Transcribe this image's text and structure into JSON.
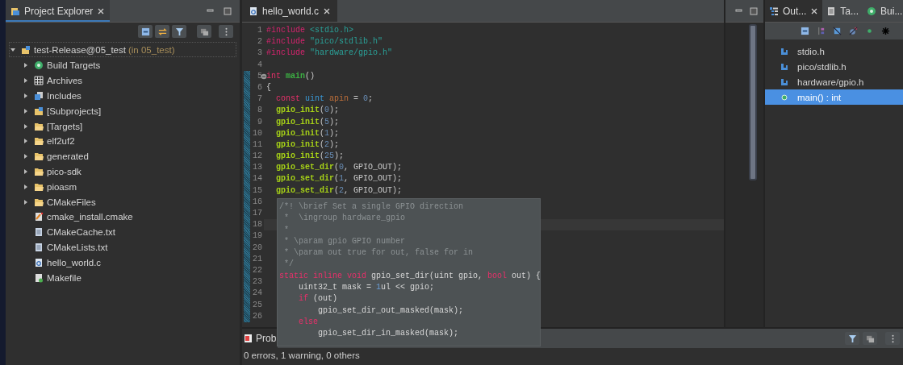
{
  "project_explorer": {
    "tab": {
      "label": "Project Explorer",
      "selected": true
    },
    "root": {
      "label": "test-Release@05_test",
      "suffix": "(in 05_test)",
      "expanded": true,
      "focused": true,
      "children": [
        {
          "label": "Build Targets",
          "kind": "targets",
          "expandable": true
        },
        {
          "label": "Archives",
          "kind": "archives",
          "expandable": true
        },
        {
          "label": "Includes",
          "kind": "includes",
          "expandable": true
        },
        {
          "label": "[Subprojects]",
          "kind": "subprojects",
          "expandable": true
        },
        {
          "label": "[Targets]",
          "kind": "folder",
          "expandable": true
        },
        {
          "label": "elf2uf2",
          "kind": "folder",
          "expandable": true
        },
        {
          "label": "generated",
          "kind": "folder",
          "expandable": true
        },
        {
          "label": "pico-sdk",
          "kind": "folder",
          "expandable": true
        },
        {
          "label": "pioasm",
          "kind": "folder",
          "expandable": true
        },
        {
          "label": "CMakeFiles",
          "kind": "folder",
          "expandable": true
        },
        {
          "label": "cmake_install.cmake",
          "kind": "cmake",
          "expandable": false
        },
        {
          "label": "CMakeCache.txt",
          "kind": "text",
          "expandable": false
        },
        {
          "label": "CMakeLists.txt",
          "kind": "text",
          "expandable": false
        },
        {
          "label": "hello_world.c",
          "kind": "csource",
          "expandable": false
        },
        {
          "label": "Makefile",
          "kind": "makefile",
          "expandable": false
        }
      ]
    }
  },
  "editor": {
    "tab": {
      "label": "hello_world.c",
      "selected": true
    },
    "lines": [
      {
        "number": "1",
        "tokens": [
          {
            "text": "#include",
            "kind": "pre"
          },
          {
            "text": " <stdio.h>",
            "kind": "str"
          }
        ]
      },
      {
        "number": "2",
        "tokens": [
          {
            "text": "#include",
            "kind": "pre"
          },
          {
            "text": " \"pico/stdlib.h\"",
            "kind": "str"
          }
        ]
      },
      {
        "number": "3",
        "tokens": [
          {
            "text": "#include",
            "kind": "pre"
          },
          {
            "text": " \"hardware/gpio.h\"",
            "kind": "str"
          }
        ]
      },
      {
        "number": "4"
      },
      {
        "number": "5",
        "changed": true,
        "tokens": [
          {
            "text": "int",
            "kind": "kw"
          },
          {
            "text": " main",
            "kind": "entry"
          },
          {
            "text": "()",
            "kind": "plain"
          }
        ]
      },
      {
        "number": "6",
        "changed": true,
        "tokens": [
          {
            "text": "{",
            "kind": "plain"
          }
        ]
      },
      {
        "number": "7",
        "changed": true,
        "tokens": [
          {
            "text": "  const",
            "kind": "kw"
          },
          {
            "text": " uint",
            "kind": "type"
          },
          {
            "text": " apin",
            "kind": "var"
          },
          {
            "text": " = ",
            "kind": "plain"
          },
          {
            "text": "0",
            "kind": "num"
          },
          {
            "text": ";",
            "kind": "plain"
          }
        ]
      },
      {
        "number": "8",
        "changed": true,
        "tokens": [
          {
            "text": "  gpio_init",
            "kind": "fn"
          },
          {
            "text": "(",
            "kind": "plain"
          },
          {
            "text": "0",
            "kind": "num"
          },
          {
            "text": ");",
            "kind": "plain"
          }
        ]
      },
      {
        "number": "9",
        "changed": true,
        "tokens": [
          {
            "text": "  gpio_init",
            "kind": "fn"
          },
          {
            "text": "(",
            "kind": "plain"
          },
          {
            "text": "5",
            "kind": "num"
          },
          {
            "text": ");",
            "kind": "plain"
          }
        ]
      },
      {
        "number": "10",
        "changed": true,
        "tokens": [
          {
            "text": "  gpio_init",
            "kind": "fn"
          },
          {
            "text": "(",
            "kind": "plain"
          },
          {
            "text": "1",
            "kind": "num"
          },
          {
            "text": ");",
            "kind": "plain"
          }
        ]
      },
      {
        "number": "11",
        "changed": true,
        "tokens": [
          {
            "text": "  gpio_init",
            "kind": "fn"
          },
          {
            "text": "(",
            "kind": "plain"
          },
          {
            "text": "2",
            "kind": "num"
          },
          {
            "text": ");",
            "kind": "plain"
          }
        ]
      },
      {
        "number": "12",
        "changed": true,
        "tokens": [
          {
            "text": "  gpio_init",
            "kind": "fn"
          },
          {
            "text": "(",
            "kind": "plain"
          },
          {
            "text": "25",
            "kind": "num"
          },
          {
            "text": ");",
            "kind": "plain"
          }
        ]
      },
      {
        "number": "13",
        "changed": true,
        "tokens": [
          {
            "text": "  gpio_set_dir",
            "kind": "fn"
          },
          {
            "text": "(",
            "kind": "plain"
          },
          {
            "text": "0",
            "kind": "num"
          },
          {
            "text": ", GPIO_OUT);",
            "kind": "plain"
          }
        ]
      },
      {
        "number": "14",
        "changed": true,
        "tokens": [
          {
            "text": "  gpio_set_dir",
            "kind": "fn"
          },
          {
            "text": "(",
            "kind": "plain"
          },
          {
            "text": "1",
            "kind": "num"
          },
          {
            "text": ", GPIO_OUT);",
            "kind": "plain"
          }
        ]
      },
      {
        "number": "15",
        "changed": true,
        "tokens": [
          {
            "text": "  gpio_set_dir",
            "kind": "fn"
          },
          {
            "text": "(",
            "kind": "plain"
          },
          {
            "text": "2",
            "kind": "num"
          },
          {
            "text": ", GPIO_OUT);",
            "kind": "plain"
          }
        ]
      },
      {
        "number": "16",
        "changed": true
      },
      {
        "number": "17",
        "changed": true
      },
      {
        "number": "18",
        "changed": true
      },
      {
        "number": "19",
        "changed": true
      },
      {
        "number": "20",
        "changed": true
      },
      {
        "number": "21",
        "changed": true
      },
      {
        "number": "22",
        "changed": true
      },
      {
        "number": "23",
        "changed": true
      },
      {
        "number": "24",
        "changed": true
      },
      {
        "number": "25",
        "changed": true
      },
      {
        "number": "26",
        "changed": true
      }
    ]
  },
  "hover": {
    "lines": [
      [
        {
          "text": "/*! \\brief Set a single GPIO direction",
          "kind": "comment"
        }
      ],
      [
        {
          "text": " *  \\ingroup hardware_gpio",
          "kind": "comment"
        }
      ],
      [
        {
          "text": " *",
          "kind": "comment"
        }
      ],
      [
        {
          "text": " * \\param gpio GPIO number",
          "kind": "comment"
        }
      ],
      [
        {
          "text": " * \\param out true for out, false for in",
          "kind": "comment"
        }
      ],
      [
        {
          "text": " */",
          "kind": "comment"
        }
      ],
      [
        {
          "text": "static",
          "kind": "kw"
        },
        {
          "text": " inline",
          "kind": "kw"
        },
        {
          "text": " void",
          "kind": "kw"
        },
        {
          "text": " gpio_set_dir(uint gpio, ",
          "kind": "plain"
        },
        {
          "text": "bool",
          "kind": "kw"
        },
        {
          "text": " out) {",
          "kind": "plain"
        }
      ],
      [
        {
          "text": "    uint32_t mask = ",
          "kind": "plain"
        },
        {
          "text": "1",
          "kind": "num"
        },
        {
          "text": "ul << gpio;",
          "kind": "plain"
        }
      ],
      [
        {
          "text": "    if",
          "kind": "kw"
        },
        {
          "text": " (out)",
          "kind": "plain"
        }
      ],
      [
        {
          "text": "        gpio_set_dir_out_masked(mask);",
          "kind": "plain"
        }
      ],
      [
        {
          "text": "    else",
          "kind": "kw"
        }
      ],
      [
        {
          "text": "        gpio_set_dir_in_masked(mask);",
          "kind": "plain"
        }
      ]
    ]
  },
  "right_tabs": [
    {
      "label": "Out...",
      "selected": true,
      "kind": "outline"
    },
    {
      "label": "Ta...",
      "selected": false,
      "kind": "tasks"
    },
    {
      "label": "Bui...",
      "selected": false,
      "kind": "build"
    }
  ],
  "outline": [
    {
      "label": "stdio.h",
      "kind": "include",
      "selected": false
    },
    {
      "label": "pico/stdlib.h",
      "kind": "include",
      "selected": false
    },
    {
      "label": "hardware/gpio.h",
      "kind": "include",
      "selected": false
    },
    {
      "label": "main() : int",
      "kind": "function",
      "selected": true
    }
  ],
  "problems": {
    "tab": "Prob",
    "summary": "0 errors, 1 warning, 0 others"
  }
}
